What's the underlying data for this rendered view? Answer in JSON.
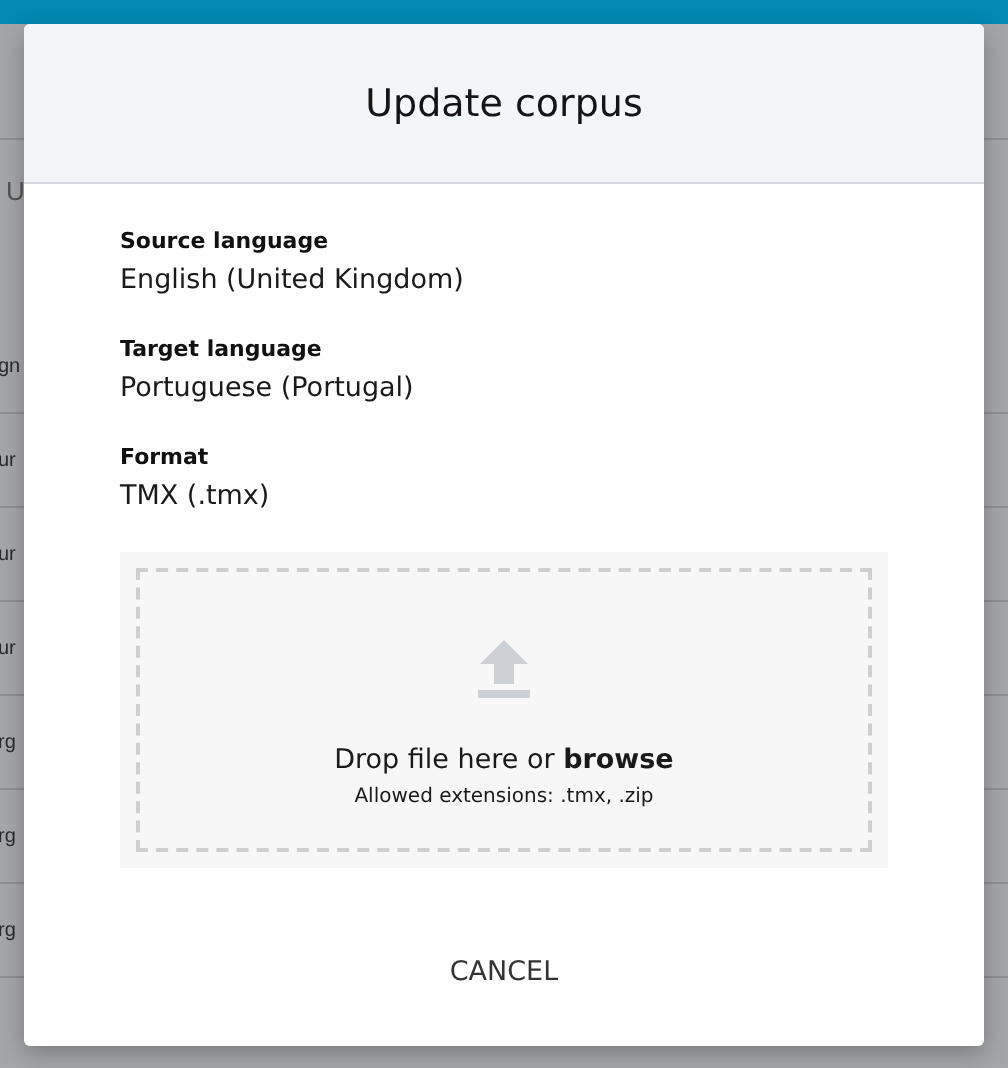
{
  "background_rows": [
    "U",
    "gn",
    "ur",
    "ur",
    "ur",
    "rg",
    "rg",
    "rg"
  ],
  "dialog": {
    "title": "Update corpus",
    "fields": [
      {
        "label": "Source language",
        "value": "English (United Kingdom)"
      },
      {
        "label": "Target language",
        "value": "Portuguese (Portugal)"
      },
      {
        "label": "Format",
        "value": "TMX (.tmx)"
      }
    ],
    "dropzone": {
      "text": "Drop file here or **browse**",
      "hint": "Allowed extensions: .tmx, .zip"
    },
    "cancel": "CANCEL"
  }
}
